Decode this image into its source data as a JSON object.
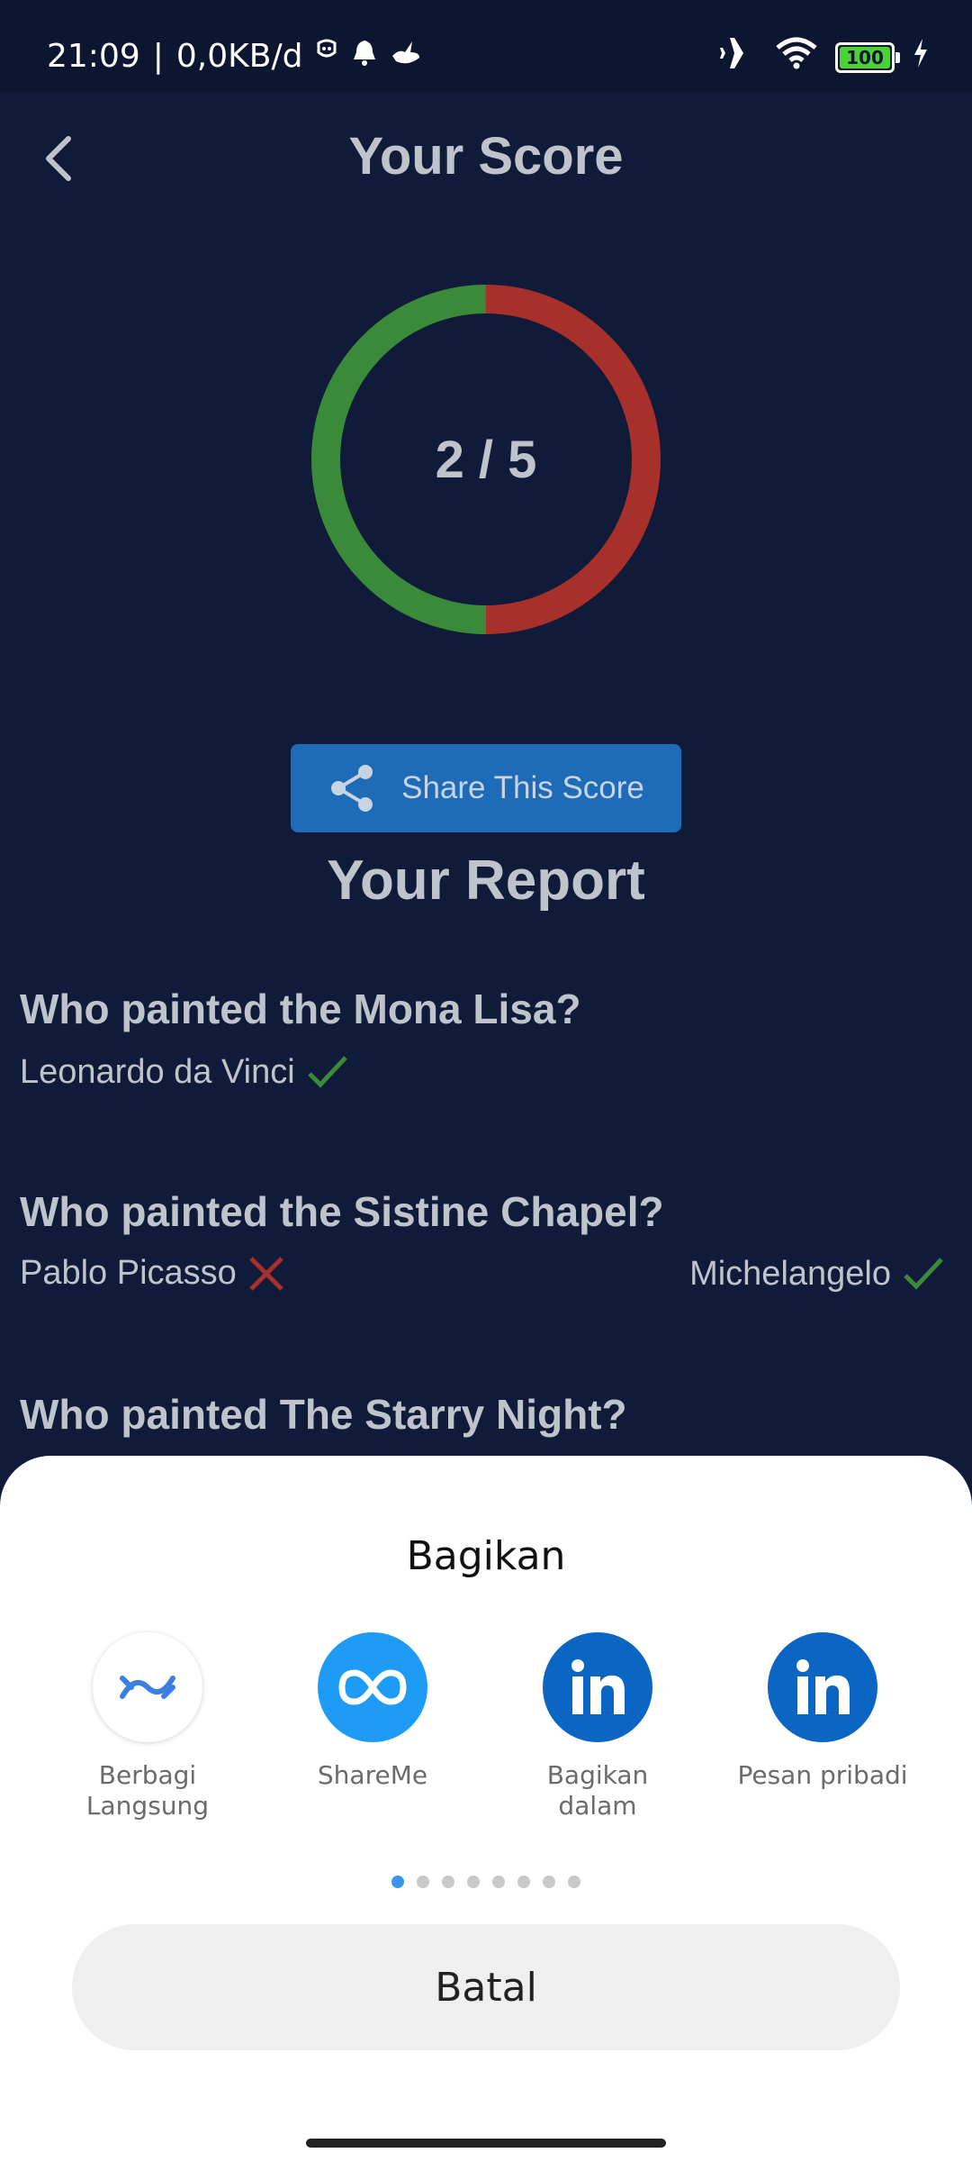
{
  "status_bar": {
    "time": "21:09",
    "separator": "|",
    "net_speed": "0,0KB/d",
    "battery": "100"
  },
  "header": {
    "title": "Your Score"
  },
  "score": {
    "text": "2 / 5",
    "correct": 2,
    "total": 5,
    "correct_color": "#3a8a3a",
    "wrong_color": "#a8302a"
  },
  "share_button": {
    "label": "Share This Score"
  },
  "report": {
    "title": "Your Report",
    "items": [
      {
        "question": "Who painted the Mona Lisa?",
        "your_answer": "Leonardo da Vinci",
        "your_answer_status": "correct"
      },
      {
        "question": "Who painted the Sistine Chapel?",
        "your_answer": "Pablo Picasso",
        "your_answer_status": "wrong",
        "correct_answer": "Michelangelo"
      },
      {
        "question": "Who painted The Starry Night?"
      }
    ]
  },
  "share_sheet": {
    "title": "Bagikan",
    "targets": [
      {
        "label": "Berbagi\nLangsung",
        "icon": "direct-share-icon"
      },
      {
        "label": "ShareMe",
        "icon": "shareme-icon"
      },
      {
        "label": "Bagikan\ndalam",
        "icon": "linkedin-icon"
      },
      {
        "label": "Pesan pribadi",
        "icon": "linkedin-icon"
      }
    ],
    "page_count": 8,
    "active_page": 1,
    "cancel_label": "Batal"
  }
}
